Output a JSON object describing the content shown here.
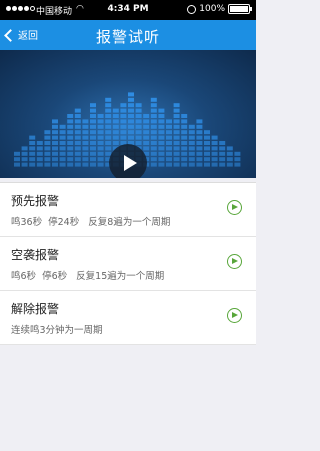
{
  "status_bar": {
    "carrier": "中国移动",
    "wifi_icon": "wifi-icon",
    "time": "4:34 PM",
    "lock_icon": "rotation-lock-icon",
    "battery": "100%"
  },
  "nav": {
    "back_label": "返回",
    "title": "报警试听"
  },
  "banner": {
    "play_icon": "play-icon"
  },
  "alarms": [
    {
      "name": "预先报警",
      "desc": "鸣36秒  停24秒   反复8遍为一个周期"
    },
    {
      "name": "空袭报警",
      "desc": "鸣6秒  停6秒   反复15遍为一个周期"
    },
    {
      "name": "解除报警",
      "desc": "连续鸣3分钟为一周期"
    }
  ],
  "colors": {
    "nav_bg": "#1c8fe3",
    "play_green": "#58a63a",
    "equalizer_bar": "#2f8ee6"
  }
}
